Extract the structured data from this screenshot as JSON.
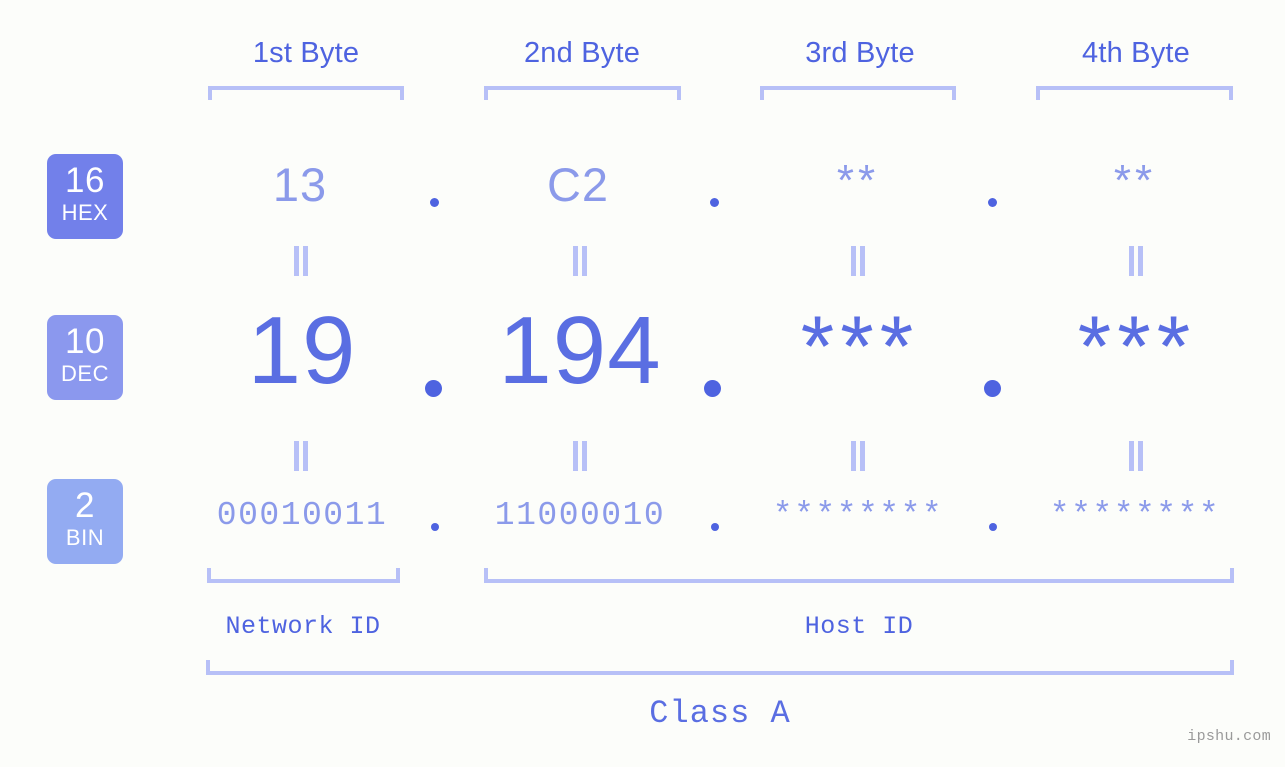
{
  "meta": {
    "background": "#fcfdfa",
    "accent_strong": "#4e63e0",
    "accent_mid": "#5a6ee2",
    "accent_light": "#8b9aea",
    "bracket": "#b7c0f7"
  },
  "byte_headers": [
    {
      "label": "1st Byte"
    },
    {
      "label": "2nd Byte"
    },
    {
      "label": "3rd Byte"
    },
    {
      "label": "4th Byte"
    }
  ],
  "bases": [
    {
      "number": "16",
      "abbr": "HEX",
      "color": "#7280ea"
    },
    {
      "number": "10",
      "abbr": "DEC",
      "color": "#8b98ee"
    },
    {
      "number": "2",
      "abbr": "BIN",
      "color": "#93abf2"
    }
  ],
  "rows": {
    "hex": {
      "values": [
        "13",
        "C2",
        "**",
        "**"
      ]
    },
    "dec": {
      "values": [
        "19",
        "194",
        "***",
        "***"
      ]
    },
    "bin": {
      "values": [
        "00010011",
        "11000010",
        "********",
        "********"
      ]
    }
  },
  "separators": {
    "hex": [
      ".",
      ".",
      "."
    ],
    "dec": [
      ".",
      ".",
      "."
    ],
    "bin": [
      ".",
      ".",
      "."
    ]
  },
  "connectors": {
    "hex_to_dec": [
      "=",
      "=",
      "=",
      "="
    ],
    "dec_to_bin": [
      "=",
      "=",
      "=",
      "="
    ]
  },
  "id_sections": [
    {
      "label": "Network ID"
    },
    {
      "label": "Host ID"
    }
  ],
  "class": {
    "label": "Class A"
  },
  "watermark": {
    "text": "ipshu.com"
  }
}
